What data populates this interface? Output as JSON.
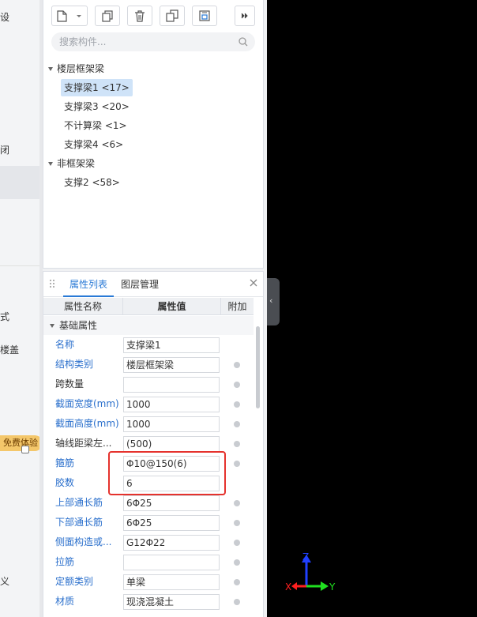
{
  "left_strip": {
    "fragments": [
      "设",
      "闭",
      "式",
      "楼盖",
      "义"
    ],
    "trial_badge": "免费体验"
  },
  "component_panel": {
    "search_placeholder": "搜索构件...",
    "tree": [
      {
        "group": "楼层框架梁",
        "children": [
          {
            "label": "支撑梁1 <17>",
            "selected": true
          },
          {
            "label": "支撑梁3 <20>",
            "selected": false
          },
          {
            "label": "不计算梁 <1>",
            "selected": false
          },
          {
            "label": "支撑梁4 <6>",
            "selected": false
          }
        ]
      },
      {
        "group": "非框架梁",
        "children": [
          {
            "label": "支撑2 <58>",
            "selected": false
          }
        ]
      }
    ]
  },
  "properties_panel": {
    "tabs": [
      "属性列表",
      "图层管理"
    ],
    "active_tab": "属性列表",
    "columns": [
      "属性名称",
      "属性值",
      "附加"
    ],
    "section": "基础属性",
    "rows": [
      {
        "name": "名称",
        "value": "支撑梁1",
        "blue": true,
        "has_radio": false
      },
      {
        "name": "结构类别",
        "value": "楼层框架梁",
        "blue": true,
        "has_radio": true
      },
      {
        "name": "跨数量",
        "value": "",
        "blue": false,
        "has_radio": true
      },
      {
        "name": "截面宽度(mm)",
        "value": "1000",
        "blue": true,
        "has_radio": true
      },
      {
        "name": "截面高度(mm)",
        "value": "1000",
        "blue": true,
        "has_radio": true
      },
      {
        "name": "轴线距梁左...",
        "value": "(500)",
        "blue": false,
        "has_radio": true
      },
      {
        "name": "箍筋",
        "value": "Φ10@150(6)",
        "blue": true,
        "has_radio": true
      },
      {
        "name": "胶数",
        "value": "6",
        "blue": true,
        "has_radio": false
      },
      {
        "name": "上部通长筋",
        "value": "6Φ25",
        "blue": true,
        "has_radio": true
      },
      {
        "name": "下部通长筋",
        "value": "6Φ25",
        "blue": true,
        "has_radio": true
      },
      {
        "name": "侧面构造或...",
        "value": "G12Φ22",
        "blue": true,
        "has_radio": true
      },
      {
        "name": "拉筋",
        "value": "",
        "blue": true,
        "has_radio": true
      },
      {
        "name": "定额类别",
        "value": "单梁",
        "blue": true,
        "has_radio": true
      },
      {
        "name": "材质",
        "value": "现浇混凝土",
        "blue": true,
        "has_radio": true
      }
    ]
  },
  "viewport": {
    "axis_labels": {
      "x": "X",
      "y": "Y",
      "z": "Z"
    },
    "colors": {
      "x": "#ff2020",
      "y": "#20e020",
      "z": "#2040ff"
    }
  }
}
